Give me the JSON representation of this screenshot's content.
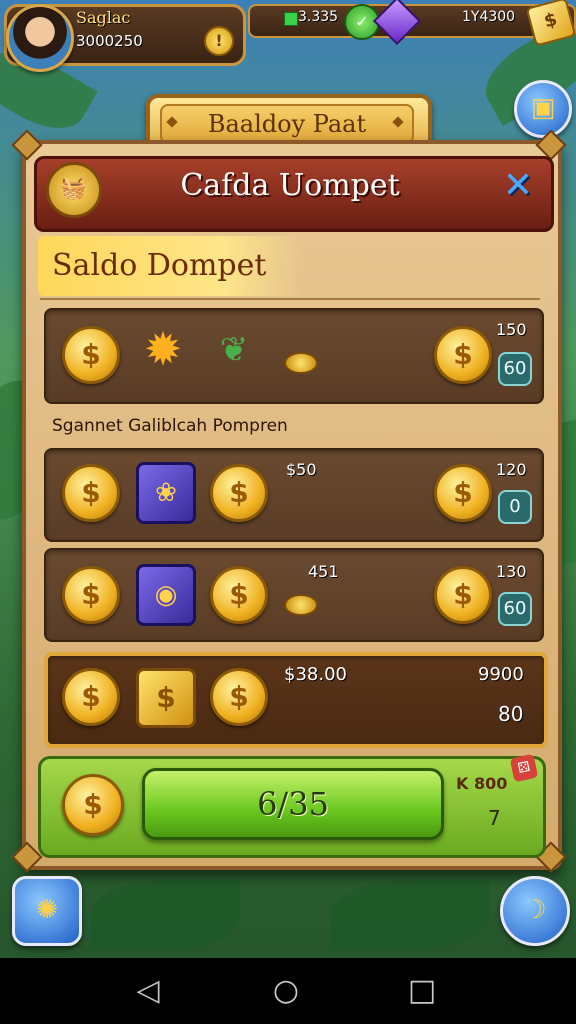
{
  "hud": {
    "player_name": "Saglac",
    "coins": "3000250",
    "coin_button_icon": "!",
    "gems": "3.335",
    "gold": "1Y4300"
  },
  "banner": {
    "title": "Baaldoy Paat"
  },
  "dialog": {
    "title": "Cafda Uompet",
    "close_icon": "✕",
    "section_label": "Saldo Dompet",
    "subtitle": "Sgannet Galiblcah Pompren"
  },
  "rows": [
    {
      "mid_value": "",
      "right_top": "150",
      "right_tag": "60"
    },
    {
      "mid_value": "$50",
      "right_top": "120",
      "right_tag": "0"
    },
    {
      "mid_value": "451",
      "right_top": "130",
      "right_tag": "60"
    },
    {
      "mid_value": "$38.00",
      "right_top": "9900",
      "right_bottom": "80"
    }
  ],
  "purchase": {
    "button_label": "6/35",
    "price_label": "K 800",
    "count": "7"
  },
  "colors": {
    "panel": "#e9c995",
    "header": "#a6402a",
    "buy_green": "#6ac820",
    "highlight_border": "#e0a63a"
  },
  "nav": {
    "back": "◁",
    "home": "○",
    "recents": "□"
  }
}
